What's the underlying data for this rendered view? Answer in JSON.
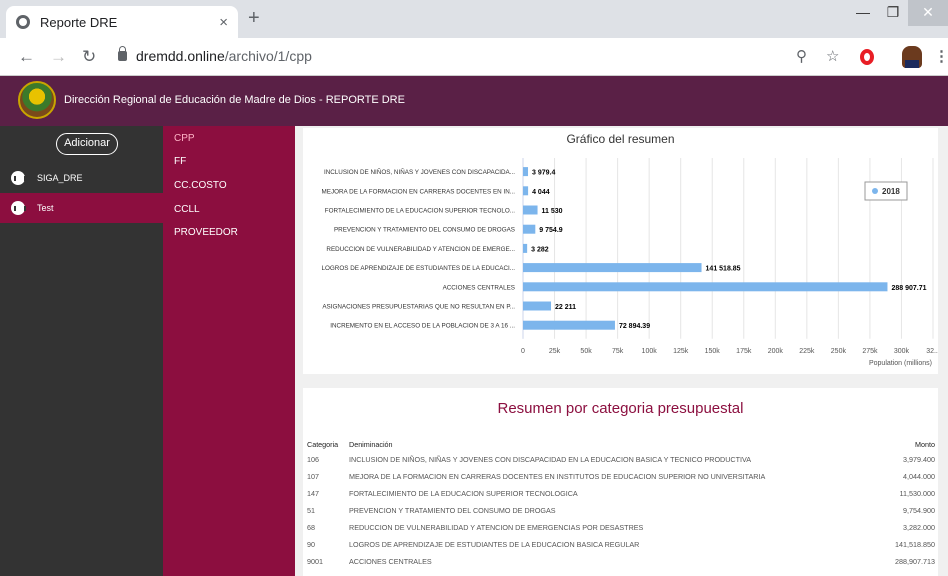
{
  "browser": {
    "tab_title": "Reporte DRE",
    "tab_close": "×",
    "new_tab": "+",
    "url_host": "dremdd.online",
    "url_path": "/archivo/1/cpp",
    "icons": [
      "back-icon",
      "forward-icon",
      "reload-icon",
      "lock-icon",
      "zoom-icon",
      "star-icon",
      "opera-icon",
      "profile-avatar",
      "menu-icon"
    ]
  },
  "header": {
    "title": "Dirección Regional de Educación de Madre de Dios - REPORTE DRE"
  },
  "sidebar": {
    "add_label": "Adicionar",
    "items": [
      {
        "label": "SIGA_DRE",
        "active": false
      },
      {
        "label": "Test",
        "active": true
      }
    ]
  },
  "submenu": {
    "items": [
      {
        "label": "CPP",
        "active": true
      },
      {
        "label": "FF",
        "active": false
      },
      {
        "label": "CC.COSTO",
        "active": false
      },
      {
        "label": "CCLL",
        "active": false
      },
      {
        "label": "PROVEEDOR",
        "active": false
      }
    ]
  },
  "chart_data": {
    "type": "bar",
    "orientation": "horizontal",
    "title": "Gráfico del resumen",
    "xlabel": "Population (millions)",
    "categories": [
      "INCLUSION DE NIÑOS, NIÑAS Y JOVENES CON DISCAPACIDA...",
      "MEJORA DE LA FORMACION EN CARRERAS DOCENTES EN IN...",
      "FORTALECIMIENTO DE LA EDUCACION SUPERIOR TECNOLO...",
      "PREVENCION Y TRATAMIENTO DEL CONSUMO DE DROGAS",
      "REDUCCION DE VULNERABILIDAD Y ATENCION DE EMERGE...",
      "LOGROS DE APRENDIZAJE DE ESTUDIANTES DE LA EDUCACI...",
      "ACCIONES CENTRALES",
      "ASIGNACIONES PRESUPUESTARIAS QUE NO RESULTAN EN P...",
      "INCREMENTO EN EL ACCESO DE LA POBLACION DE 3 A 16 ..."
    ],
    "series": [
      {
        "name": "2018",
        "color": "#7cb5ec",
        "values": [
          3979.4,
          4044,
          11530,
          9754.9,
          3282,
          141518.85,
          288907.71,
          22211,
          72894.39
        ]
      }
    ],
    "data_labels": [
      "3 979.4",
      "4 044",
      "11 530",
      "9 754.9",
      "3 282",
      "141 518.85",
      "288 907.71",
      "22 211",
      "72 894.39"
    ],
    "xlim": [
      0,
      325000
    ],
    "xticks": [
      0,
      25000,
      50000,
      75000,
      100000,
      125000,
      150000,
      175000,
      200000,
      225000,
      250000,
      275000,
      300000,
      325000
    ],
    "xtick_labels": [
      "0",
      "25k",
      "50k",
      "75k",
      "100k",
      "125k",
      "150k",
      "175k",
      "200k",
      "225k",
      "250k",
      "275k",
      "300k",
      "32..."
    ],
    "legend": "top-right",
    "grid": true
  },
  "summary": {
    "title": "Resumen por categoria presupuestal",
    "columns": [
      "Categoria",
      "Deniminación",
      "Monto"
    ],
    "rows": [
      {
        "cat": "106",
        "name": "INCLUSION DE NIÑOS, NIÑAS Y JOVENES CON DISCAPACIDAD EN LA EDUCACION BASICA Y TECNICO PRODUCTIVA",
        "monto": "3,979.400"
      },
      {
        "cat": "107",
        "name": "MEJORA DE LA FORMACION EN CARRERAS DOCENTES EN INSTITUTOS DE EDUCACION SUPERIOR NO UNIVERSITARIA",
        "monto": "4,044.000"
      },
      {
        "cat": "147",
        "name": "FORTALECIMIENTO DE LA EDUCACION SUPERIOR TECNOLOGICA",
        "monto": "11,530.000"
      },
      {
        "cat": "51",
        "name": "PREVENCION Y TRATAMIENTO DEL CONSUMO DE DROGAS",
        "monto": "9,754.900"
      },
      {
        "cat": "68",
        "name": "REDUCCION DE VULNERABILIDAD Y ATENCION DE EMERGENCIAS POR DESASTRES",
        "monto": "3,282.000"
      },
      {
        "cat": "90",
        "name": "LOGROS DE APRENDIZAJE DE ESTUDIANTES DE LA EDUCACION BASICA REGULAR",
        "monto": "141,518.850"
      },
      {
        "cat": "9001",
        "name": "ACCIONES CENTRALES",
        "monto": "288,907.713"
      }
    ]
  }
}
